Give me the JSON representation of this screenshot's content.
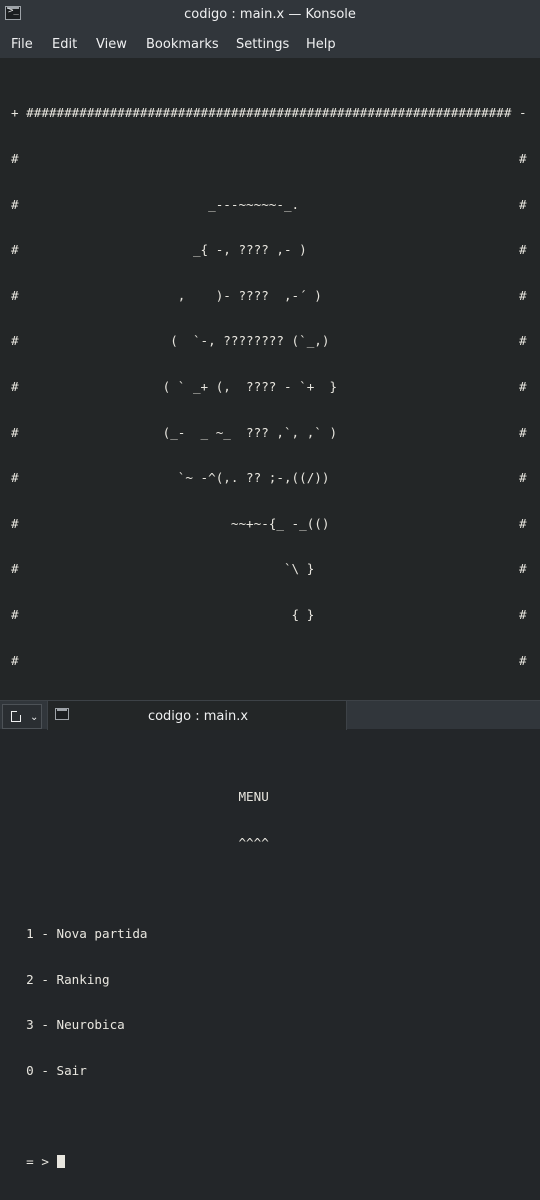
{
  "window": {
    "title": "codigo : main.x — Konsole"
  },
  "menubar": {
    "items": [
      {
        "label": "File"
      },
      {
        "label": "Edit"
      },
      {
        "label": "View"
      },
      {
        "label": "Bookmarks"
      },
      {
        "label": "Settings"
      },
      {
        "label": "Help"
      }
    ]
  },
  "terminal": {
    "lines": [
      "+ ################################################################ -",
      "#                                                                  #",
      "#                         _---~~~~~-_.                             #",
      "#                       _{ -, ???? ,- )                            #",
      "#                     ,    )- ????  ,-´ )                          #",
      "#                    (  `-, ???????? (`_,)                         #",
      "#                   ( ` _+ (,  ???? - `+  }                        #",
      "#                   (_-  _ ~_  ??? ,`, ,` )                        #",
      "#                     `~ -^(,. ?? ;-,((/))                         #",
      "#                            ~~+~-{_ -_(()                         #",
      "#                                   `\\ }                           #",
      "#                                    { }                           #",
      "#                                                                  #",
      "* ################################################################ /",
      "",
      "                              MENU",
      "                              ^^^^",
      "",
      "  1 - Nova partida",
      "  2 - Ranking",
      "  3 - Neurobica",
      "  0 - Sair",
      "",
      "  = > "
    ]
  },
  "tabs": [
    {
      "label": "codigo : main.x"
    }
  ],
  "colors": {
    "terminal_bg": "#232627",
    "chrome_bg": "#31363b",
    "text": "#eff0f1"
  }
}
